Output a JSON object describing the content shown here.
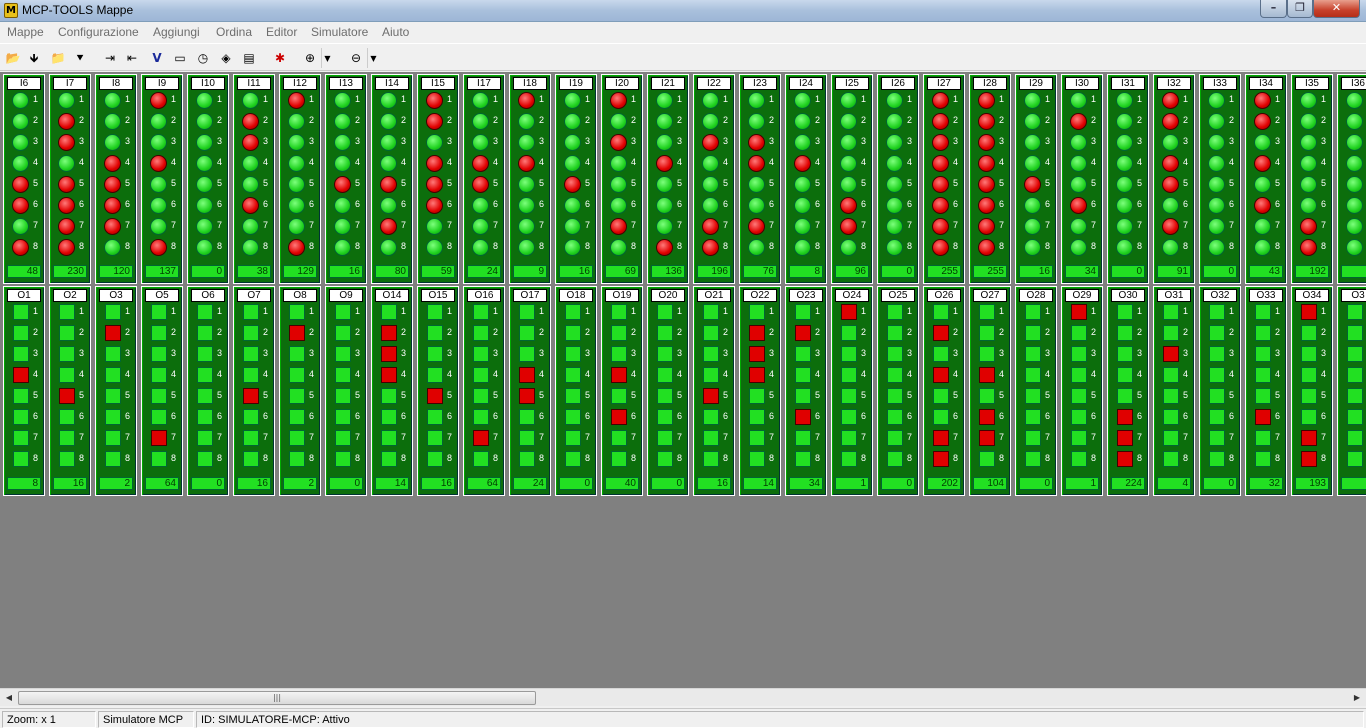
{
  "window": {
    "title": "MCP-TOOLS Mappe",
    "app_icon_glyph": "M"
  },
  "controls": {
    "minimize": "–",
    "maximize": "❐",
    "close": "✕"
  },
  "menu": [
    "Mappe",
    "Configurazione",
    "Aggiungi",
    "Ordina",
    "Editor",
    "Simulatore",
    "Aiuto"
  ],
  "toolbar": [
    {
      "icon": "open-folder-icon",
      "glyph": "📂"
    },
    {
      "icon": "save-pin-icon",
      "glyph": "🡻"
    },
    {
      "icon": "open-blue-icon",
      "glyph": "📁"
    },
    {
      "icon": "save-down-icon",
      "glyph": "⯆"
    },
    {
      "icon": "import-icon",
      "glyph": "⇥"
    },
    {
      "icon": "export-icon",
      "glyph": "⇤"
    },
    {
      "icon": "v-icon",
      "glyph": "V"
    },
    {
      "icon": "monitor-icon",
      "glyph": "▭"
    },
    {
      "icon": "clock-icon",
      "glyph": "◷"
    },
    {
      "icon": "tool-icon",
      "glyph": "◈"
    },
    {
      "icon": "document-icon",
      "glyph": "▤"
    },
    {
      "icon": "bug-icon",
      "glyph": "✱"
    },
    {
      "icon": "zoom-in-icon",
      "glyph": "⊕"
    },
    {
      "icon": "zoom-out-icon",
      "glyph": "⊖"
    }
  ],
  "inputs": [
    {
      "label": "I6",
      "value": "48",
      "active": [
        5,
        6,
        8
      ]
    },
    {
      "label": "I7",
      "value": "230",
      "active": [
        2,
        3,
        5,
        6,
        7,
        8
      ]
    },
    {
      "label": "I8",
      "value": "120",
      "active": [
        4,
        5,
        6,
        7
      ]
    },
    {
      "label": "I9",
      "value": "137",
      "active": [
        1,
        4,
        8
      ]
    },
    {
      "label": "I10",
      "value": "0",
      "active": []
    },
    {
      "label": "I11",
      "value": "38",
      "active": [
        2,
        3,
        6
      ]
    },
    {
      "label": "I12",
      "value": "129",
      "active": [
        1,
        8
      ]
    },
    {
      "label": "I13",
      "value": "16",
      "active": [
        5
      ]
    },
    {
      "label": "I14",
      "value": "80",
      "active": [
        5,
        7
      ]
    },
    {
      "label": "I15",
      "value": "59",
      "active": [
        1,
        2,
        4,
        5,
        6
      ]
    },
    {
      "label": "I17",
      "value": "24",
      "active": [
        4,
        5
      ]
    },
    {
      "label": "I18",
      "value": "9",
      "active": [
        1,
        4
      ]
    },
    {
      "label": "I19",
      "value": "16",
      "active": [
        5
      ]
    },
    {
      "label": "I20",
      "value": "69",
      "active": [
        1,
        3,
        7
      ]
    },
    {
      "label": "I21",
      "value": "136",
      "active": [
        4,
        8
      ]
    },
    {
      "label": "I22",
      "value": "196",
      "active": [
        3,
        7,
        8
      ]
    },
    {
      "label": "I23",
      "value": "76",
      "active": [
        3,
        4,
        7
      ]
    },
    {
      "label": "I24",
      "value": "8",
      "active": [
        4
      ]
    },
    {
      "label": "I25",
      "value": "96",
      "active": [
        6,
        7
      ]
    },
    {
      "label": "I26",
      "value": "0",
      "active": []
    },
    {
      "label": "I27",
      "value": "255",
      "active": [
        1,
        2,
        3,
        4,
        5,
        6,
        7,
        8
      ]
    },
    {
      "label": "I28",
      "value": "255",
      "active": [
        1,
        2,
        3,
        4,
        5,
        6,
        7,
        8
      ]
    },
    {
      "label": "I29",
      "value": "16",
      "active": [
        5
      ]
    },
    {
      "label": "I30",
      "value": "34",
      "active": [
        2,
        6
      ]
    },
    {
      "label": "I31",
      "value": "0",
      "active": []
    },
    {
      "label": "I32",
      "value": "91",
      "active": [
        1,
        2,
        4,
        5,
        7
      ]
    },
    {
      "label": "I33",
      "value": "0",
      "active": []
    },
    {
      "label": "I34",
      "value": "43",
      "active": [
        1,
        2,
        4,
        6
      ]
    },
    {
      "label": "I35",
      "value": "192",
      "active": [
        7,
        8
      ]
    },
    {
      "label": "I36",
      "value": "",
      "active": []
    }
  ],
  "outputs": [
    {
      "label": "O1",
      "value": "8",
      "active": [
        4
      ]
    },
    {
      "label": "O2",
      "value": "16",
      "active": [
        5
      ]
    },
    {
      "label": "O3",
      "value": "2",
      "active": [
        2
      ]
    },
    {
      "label": "O5",
      "value": "64",
      "active": [
        7
      ]
    },
    {
      "label": "O6",
      "value": "0",
      "active": []
    },
    {
      "label": "O7",
      "value": "16",
      "active": [
        5
      ]
    },
    {
      "label": "O8",
      "value": "2",
      "active": [
        2
      ]
    },
    {
      "label": "O9",
      "value": "0",
      "active": []
    },
    {
      "label": "O14",
      "value": "14",
      "active": [
        2,
        3,
        4
      ]
    },
    {
      "label": "O15",
      "value": "16",
      "active": [
        5
      ]
    },
    {
      "label": "O16",
      "value": "64",
      "active": [
        7
      ]
    },
    {
      "label": "O17",
      "value": "24",
      "active": [
        4,
        5
      ]
    },
    {
      "label": "O18",
      "value": "0",
      "active": []
    },
    {
      "label": "O19",
      "value": "40",
      "active": [
        4,
        6
      ]
    },
    {
      "label": "O20",
      "value": "0",
      "active": []
    },
    {
      "label": "O21",
      "value": "16",
      "active": [
        5
      ]
    },
    {
      "label": "O22",
      "value": "14",
      "active": [
        2,
        3,
        4
      ]
    },
    {
      "label": "O23",
      "value": "34",
      "active": [
        2,
        6
      ]
    },
    {
      "label": "O24",
      "value": "1",
      "active": [
        1
      ]
    },
    {
      "label": "O25",
      "value": "0",
      "active": []
    },
    {
      "label": "O26",
      "value": "202",
      "active": [
        2,
        4,
        7,
        8
      ]
    },
    {
      "label": "O27",
      "value": "104",
      "active": [
        4,
        6,
        7
      ]
    },
    {
      "label": "O28",
      "value": "0",
      "active": []
    },
    {
      "label": "O29",
      "value": "1",
      "active": [
        1
      ]
    },
    {
      "label": "O30",
      "value": "224",
      "active": [
        6,
        7,
        8
      ]
    },
    {
      "label": "O31",
      "value": "4",
      "active": [
        3
      ]
    },
    {
      "label": "O32",
      "value": "0",
      "active": []
    },
    {
      "label": "O33",
      "value": "32",
      "active": [
        6
      ]
    },
    {
      "label": "O34",
      "value": "193",
      "active": [
        1,
        7,
        8
      ]
    },
    {
      "label": "O3",
      "value": "",
      "active": []
    }
  ],
  "scrollbar": {
    "left_arrow": "◀",
    "right_arrow": "▶",
    "thumb_grip": "|||",
    "position": 0.0
  },
  "status": {
    "zoom": "Zoom: x 1",
    "mode": "Simulatore MCP",
    "id": "ID: SIMULATORE-MCP: Attivo"
  }
}
